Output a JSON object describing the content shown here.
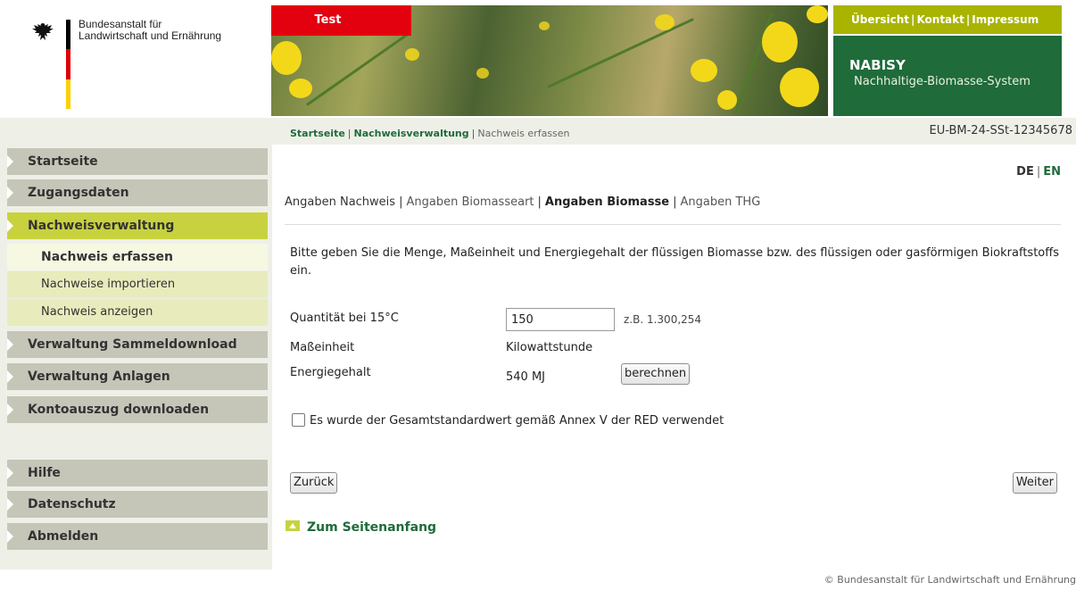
{
  "logo": {
    "line1": "Bundesanstalt für",
    "line2": "Landwirtschaft und Ernährung"
  },
  "banner": {
    "test_label": "Test"
  },
  "topnav": {
    "overview": "Übersicht",
    "contact": "Kontakt",
    "imprint": "Impressum",
    "separator": "|"
  },
  "brand": {
    "name": "NABISY",
    "subtitle": "Nachhaltige-Biomasse-System"
  },
  "breadcrumb": {
    "items": [
      "Startseite",
      "Nachweisverwaltung"
    ],
    "current": "Nachweis erfassen",
    "separator": "|"
  },
  "document_id": "EU-BM-24-SSt-12345678",
  "sidebar": {
    "items": [
      {
        "label": "Startseite"
      },
      {
        "label": "Zugangsdaten"
      },
      {
        "label": "Nachweisverwaltung"
      },
      {
        "label": "Verwaltung Sammeldownload"
      },
      {
        "label": "Verwaltung Anlagen"
      },
      {
        "label": "Kontoauszug downloaden"
      },
      {
        "label": "Hilfe"
      },
      {
        "label": "Datenschutz"
      },
      {
        "label": "Abmelden"
      }
    ],
    "subitems": [
      {
        "label": "Nachweis erfassen"
      },
      {
        "label": "Nachweise importieren"
      },
      {
        "label": "Nachweis anzeigen"
      }
    ]
  },
  "lang": {
    "de": "DE",
    "en": "EN",
    "separator": "|"
  },
  "steps": {
    "items": [
      "Angaben Nachweis",
      "Angaben Biomasseart",
      "Angaben Biomasse",
      "Angaben THG"
    ],
    "separator": "|"
  },
  "form": {
    "intro": "Bitte geben Sie die Menge, Maßeinheit und Energiegehalt der flüssigen Biomasse bzw. des flüssigen oder gasförmigen Biokraftstoffs ein.",
    "quantity_label": "Quantität bei 15°C",
    "quantity_value": "150",
    "quantity_hint": "z.B. 1.300,254",
    "unit_label": "Maßeinheit",
    "unit_value": "Kilowattstunde",
    "energy_label": "Energiegehalt",
    "energy_value": "540 MJ",
    "calculate_button": "berechnen",
    "checkbox_label": "Es wurde der Gesamtstandardwert gemäß Annex V der RED verwendet",
    "back_button": "Zurück",
    "next_button": "Weiter"
  },
  "to_top": "Zum Seitenanfang",
  "footer": "© Bundesanstalt für Landwirtschaft und Ernährung"
}
